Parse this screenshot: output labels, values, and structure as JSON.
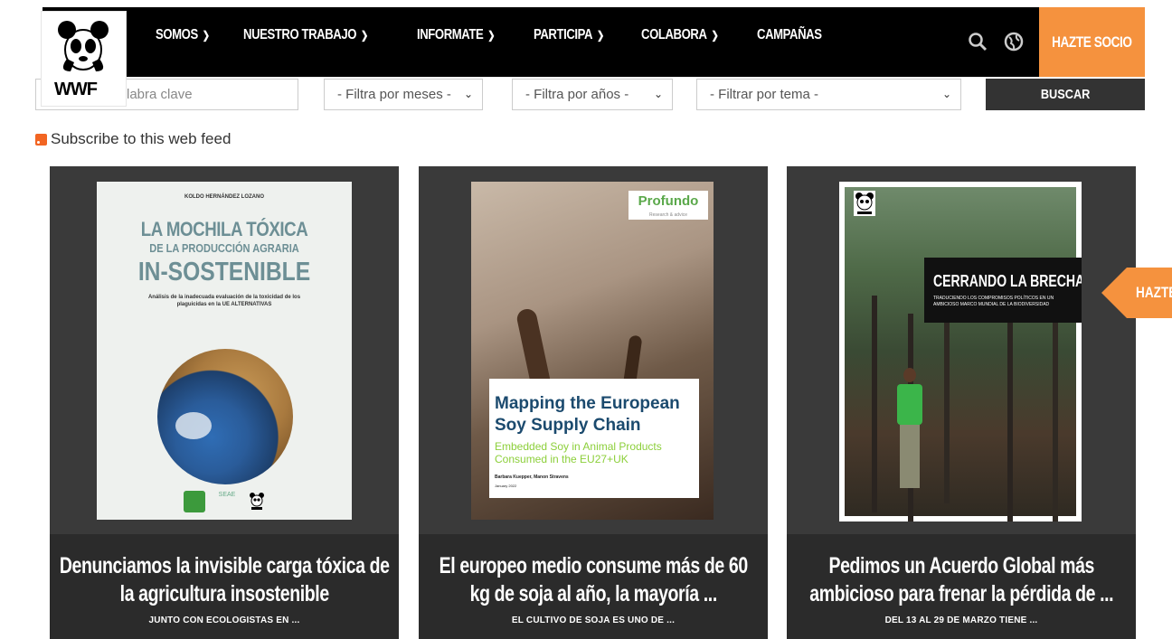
{
  "brand": {
    "logo_text": "WWF"
  },
  "nav": {
    "items": [
      {
        "label": "SOMOS",
        "has_menu": true
      },
      {
        "label": "NUESTRO TRABAJO",
        "has_menu": true
      },
      {
        "label": "INFORMATE",
        "has_menu": true
      },
      {
        "label": "PARTICIPA",
        "has_menu": true
      },
      {
        "label": "COLABORA",
        "has_menu": true
      },
      {
        "label": "CAMPAÑAS",
        "has_menu": false
      }
    ],
    "cta": "HAZTE SOCIO",
    "accent_color": "#f5923e"
  },
  "filters": {
    "search_value": "labra clave",
    "month_select": "- Filtra por meses -",
    "year_select": "- Filtra por años -",
    "topic_select": "- Filtrar por tema -",
    "submit": "BUSCAR"
  },
  "feed": {
    "label": "Subscribe to this web feed"
  },
  "cards": [
    {
      "title": "Denunciamos la invisible carga tóxica de la agricultura insostenible",
      "teaser": "JUNTO CON ECOLOGISTAS EN ...",
      "cover": {
        "author": "KOLDO HERNÁNDEZ LOZANO",
        "line1": "LA MOCHILA TÓXICA",
        "line2": "DE LA PRODUCCIÓN AGRARIA",
        "line3": "IN-SOSTENIBLE",
        "desc": "Análisis de la inadecuada evaluación de la toxicidad de los plaguicidas en la UE ALTERNATIVAS",
        "partner": "SEAE"
      }
    },
    {
      "title": "El europeo medio consume más de 60 kg de soja al año, la mayoría ...",
      "teaser": "EL CULTIVO DE SOJA ES UNO DE ...",
      "cover": {
        "brand": "Profundo",
        "brand_sub": "Research & advice",
        "headline": "Mapping the European Soy Supply Chain",
        "subhead": "Embedded Soy in Animal Products Consumed in the EU27+UK",
        "authors": "Barbara Kuepper, Manon Stravens",
        "date": "January 2022"
      }
    },
    {
      "title": "Pedimos un Acuerdo Global más ambicioso para frenar la pérdida de ...",
      "teaser": "DEL 13 AL 29 DE MARZO TIENE ...",
      "cover": {
        "headline": "CERRANDO LA BRECHA",
        "subhead": "TRADUCIENDO LOS COMPROMISOS POLÍTICOS EN UN AMBICIOSO MARCO MUNDIAL DE LA BIODIVERSIDAD"
      }
    }
  ],
  "side_tab": {
    "label": "HAZTE"
  }
}
